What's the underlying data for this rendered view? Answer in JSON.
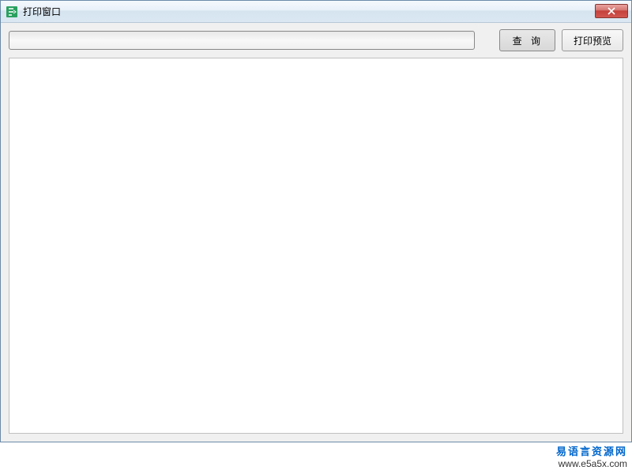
{
  "window": {
    "title": "打印窗口"
  },
  "toolbar": {
    "search_value": "",
    "query_label": "查 询",
    "preview_label": "打印预览"
  },
  "watermark": {
    "line1": "易语言资源网",
    "line2": "www.e5a5x.com"
  }
}
